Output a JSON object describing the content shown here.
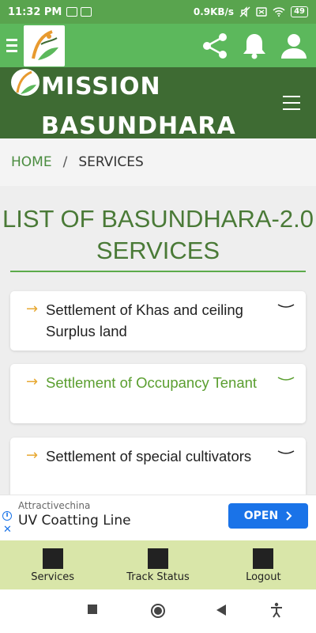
{
  "status_bar": {
    "time": "11:32 PM",
    "network_speed": "0.9KB/s",
    "battery": "49"
  },
  "app_bar": {
    "icons": [
      "menu-icon",
      "app-logo",
      "share-icon",
      "bell-icon",
      "user-icon"
    ]
  },
  "site_header": {
    "title": "MISSION BASUNDHARA"
  },
  "breadcrumb": {
    "home": "HOME",
    "separator": "/",
    "current": "SERVICES"
  },
  "page": {
    "title": "LIST OF BASUNDHARA-2.0 SERVICES"
  },
  "services": [
    {
      "label": "Settlement of Khas and ceiling Surplus land",
      "active": false
    },
    {
      "label": "Settlement of Occupancy Tenant",
      "active": true
    },
    {
      "label": "Settlement of special cultivators",
      "active": false
    }
  ],
  "ad": {
    "sponsor": "Attractivechina",
    "headline": "UV Coatting Line",
    "cta": "OPEN"
  },
  "bottom_nav": {
    "items": [
      {
        "label": "Services"
      },
      {
        "label": "Track Status"
      },
      {
        "label": "Logout"
      }
    ]
  },
  "colors": {
    "status_bar": "#59a44e",
    "app_bar": "#5cb85c",
    "header": "#3e6b33",
    "accent_green": "#4a7a37",
    "arrow": "#e7a832",
    "ad_button": "#1a73e8",
    "bottom_nav": "#d9e6a9"
  }
}
